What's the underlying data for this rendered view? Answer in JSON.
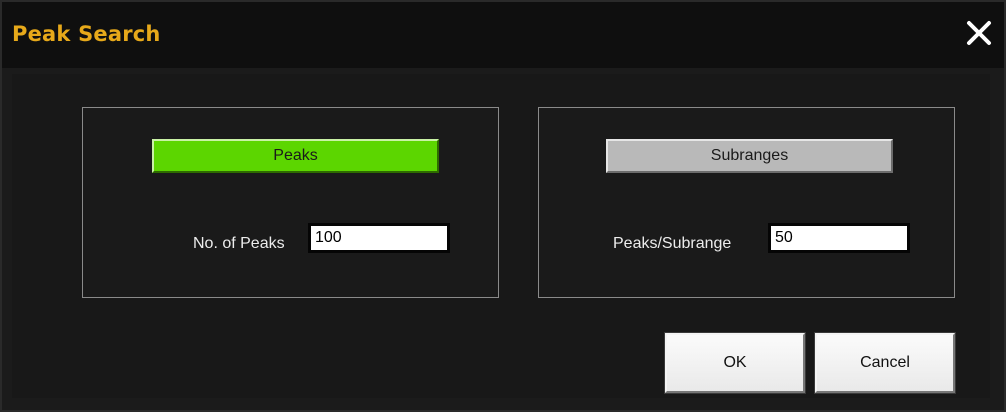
{
  "window": {
    "title": "Peak Search",
    "close_icon": "close-icon"
  },
  "peaks_group": {
    "mode_button_label": "Peaks",
    "mode_button_color": "#5cd600",
    "field_label": "No. of Peaks",
    "field_value": "100"
  },
  "subranges_group": {
    "mode_button_label": "Subranges",
    "mode_button_color": "#b9b9b9",
    "field_label": "Peaks/Subrange",
    "field_value": "50"
  },
  "actions": {
    "ok_label": "OK",
    "cancel_label": "Cancel"
  },
  "colors": {
    "title_color": "#e7a91a",
    "background": "#1b1b1b"
  }
}
